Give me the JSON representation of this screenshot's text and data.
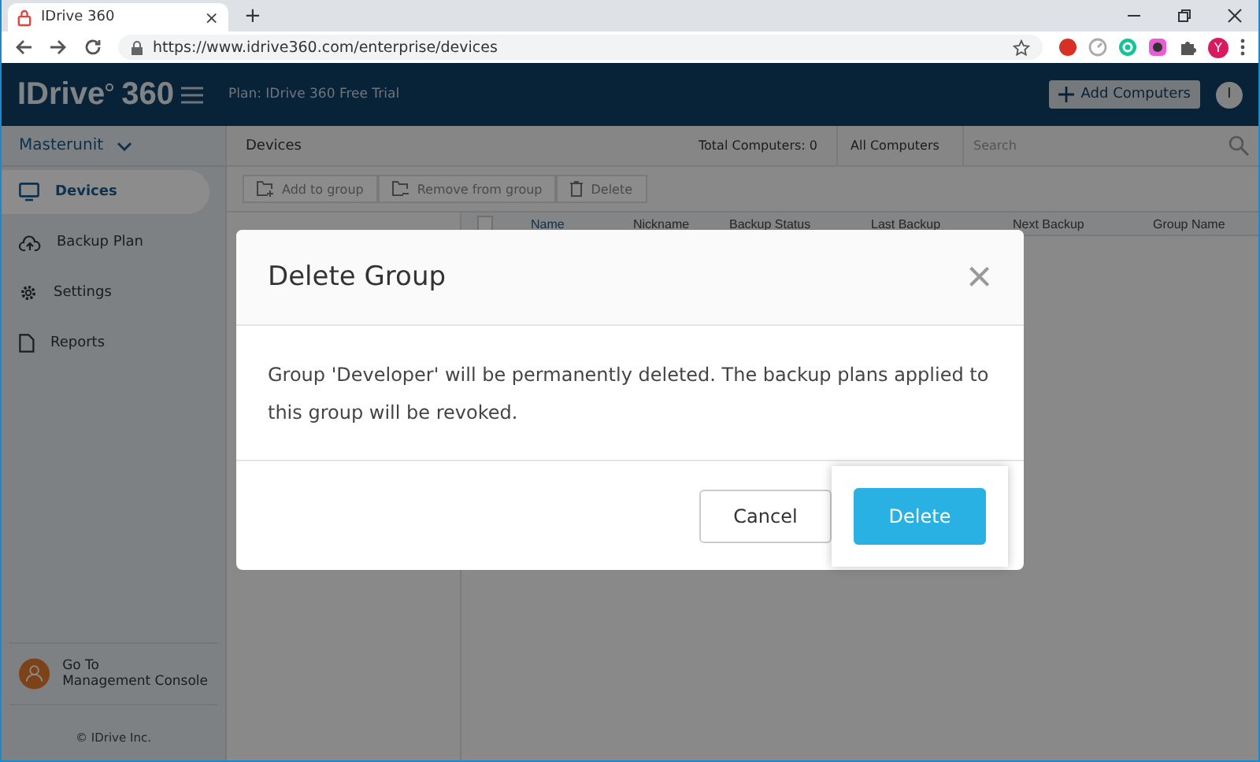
{
  "browser": {
    "tab_title": "IDrive 360",
    "tab_close": "×",
    "new_tab": "+",
    "url": "https://www.idrive360.com/enterprise/devices",
    "profile": "Y"
  },
  "header": {
    "logo": "IDrive",
    "logo_suffix": "360",
    "plan": "Plan: IDrive 360 Free Trial",
    "add_button": "Add Computers",
    "avatar": "I"
  },
  "sidebar": {
    "account": "Masterunit",
    "items": [
      {
        "label": "Devices",
        "selected": true
      },
      {
        "label": "Backup Plan",
        "selected": false
      },
      {
        "label": "Settings",
        "selected": false
      },
      {
        "label": "Reports",
        "selected": false
      }
    ],
    "console_link": [
      "Go To",
      "Management Console"
    ],
    "copyright": "© IDrive Inc."
  },
  "toolbar": {
    "title": "Devices",
    "total": "Total Computers: 0",
    "filter": "All Computers",
    "search_placeholder": "Search",
    "actions": [
      {
        "label": "Add to group"
      },
      {
        "label": "Remove from group"
      },
      {
        "label": "Delete"
      }
    ]
  },
  "table": {
    "select_all_checked": false,
    "columns": [
      "Name",
      "Nickname",
      "Backup Status",
      "Last Backup",
      "Next Backup",
      "Group Name"
    ]
  },
  "dialog": {
    "title": "Delete Group",
    "close": "×",
    "message": "Group 'Developer' will be permanently deleted. The backup plans applied to this group will be revoked.",
    "cancel": "Cancel",
    "confirm": "Delete"
  }
}
